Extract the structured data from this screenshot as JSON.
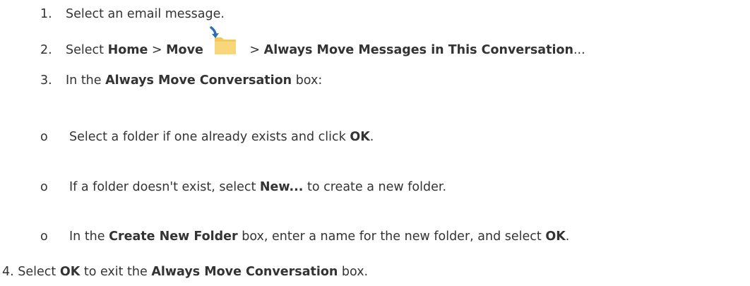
{
  "steps": {
    "s1": {
      "num": "1.",
      "text": "Select an email message."
    },
    "s2": {
      "num": "2.",
      "t1": "Select ",
      "home": "Home",
      "gt1": " > ",
      "move": "Move",
      "icon": "move-folder-icon",
      "gt2": " > ",
      "always": "Always Move Messages in This Conversation",
      "ellipsis": "..."
    },
    "s3": {
      "num": "3.",
      "t1": "In the ",
      "box": "Always Move Conversation",
      "t2": " box:"
    },
    "s4": {
      "num": "4.",
      "t1": " Select ",
      "ok": "OK",
      "t2": " to exit the ",
      "box": "Always Move Conversation",
      "t3": " box."
    }
  },
  "subs": {
    "a": {
      "bullet": "o",
      "t1": "Select a folder if one already exists and click ",
      "ok": "OK",
      "t2": "."
    },
    "b": {
      "bullet": "o",
      "t1": "If a folder doesn't exist, select ",
      "new": "New...",
      "t2": " to create a new folder."
    },
    "c": {
      "bullet": "o",
      "t1": "In the ",
      "box": "Create New Folder",
      "t2": " box, enter a name for the new folder, and select ",
      "ok": "OK",
      "t3": "."
    }
  },
  "colors": {
    "text": "#333333",
    "folder": "#f5c85a",
    "arrow": "#2c6fb6"
  }
}
